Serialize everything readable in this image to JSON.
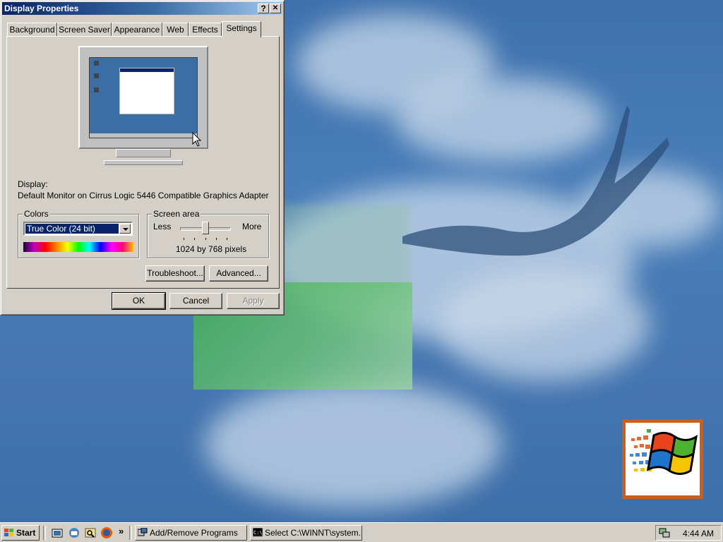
{
  "window": {
    "title": "Display Properties",
    "help_btn": "?",
    "close_btn": "✕",
    "tabs": [
      "Background",
      "Screen Saver",
      "Appearance",
      "Web",
      "Effects",
      "Settings"
    ],
    "active_tab": "Settings"
  },
  "settings": {
    "display_label": "Display:",
    "display_value": "Default Monitor on Cirrus Logic 5446 Compatible Graphics Adapter",
    "colors_group": "Colors",
    "colors_selected": "True Color (24 bit)",
    "screen_area_group": "Screen area",
    "less_label": "Less",
    "more_label": "More",
    "resolution_text": "1024 by 768 pixels",
    "slider_level": 0.5,
    "troubleshoot_btn": "Troubleshoot...",
    "advanced_btn": "Advanced..."
  },
  "dialog_buttons": {
    "ok": "OK",
    "cancel": "Cancel",
    "apply": "Apply"
  },
  "taskbar": {
    "start_label": "Start",
    "quick_launch": [
      "show-desktop-icon",
      "outlook-express-icon",
      "explorer-icon",
      "firefox-icon"
    ],
    "overflow": "»",
    "tasks": [
      "Add/Remove Programs",
      "Select C:\\WINNT\\system..."
    ],
    "clock": "4:44 AM"
  },
  "colors": {
    "titlebar_start": "#0a246a",
    "titlebar_end": "#a6caf0",
    "desktop": "#3b6ea5",
    "face": "#d4d0c8"
  }
}
